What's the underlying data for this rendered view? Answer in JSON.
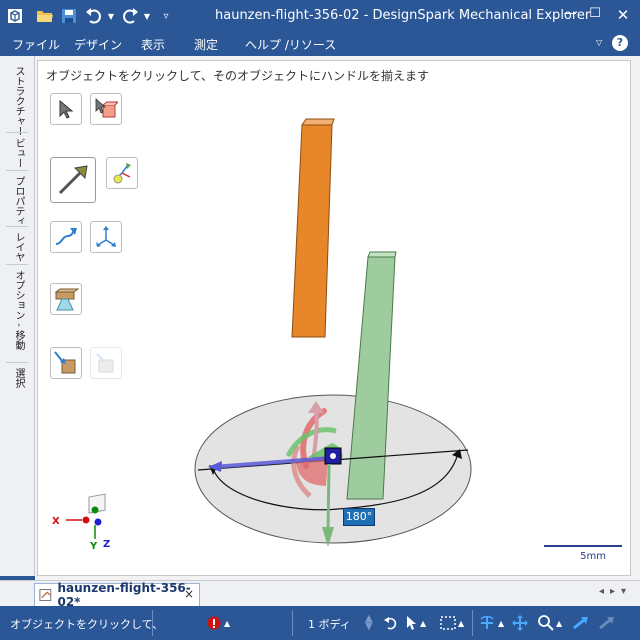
{
  "window": {
    "title": "haunzen-flight-356-02 - DesignSpark Mechanical Explorer"
  },
  "menu": {
    "file": "ファイル",
    "design": "デザイン",
    "view": "表示",
    "measure": "測定",
    "help": "ヘルプ /リソース"
  },
  "side_tabs": [
    "ストラクチャー",
    "ビュー",
    "プロパティ",
    "レイヤ",
    "オプション - 移動",
    "選択"
  ],
  "viewport": {
    "hint": "オブジェクトをクリックして、そのオブジェクトにハンドルを揃えます",
    "angle_label": "180°",
    "scale_label": "5mm",
    "axis_x": "X",
    "axis_y": "Y",
    "axis_z": "Z"
  },
  "doc_tab": {
    "label": "haunzen-flight-356-02*",
    "close": "×"
  },
  "status": {
    "text": "オブジェクトをクリックして、",
    "body_count": "1 ボディ"
  },
  "colors": {
    "chrome": "#2b5797",
    "orange_body": "#e8872a",
    "green_body": "#9ecc9e",
    "disc": "#e3e3e3"
  }
}
